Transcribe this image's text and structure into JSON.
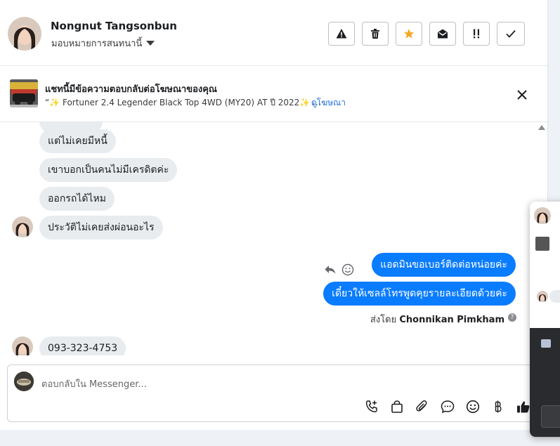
{
  "header": {
    "contact_name": "Nongnut Tangsonbun",
    "assign_label": "มอบหมายการสนทนานี้"
  },
  "toolbar": {
    "buttons": [
      {
        "name": "report-button",
        "icon": "warning-icon"
      },
      {
        "name": "delete-button",
        "icon": "trash-icon"
      },
      {
        "name": "star-button",
        "icon": "star-icon",
        "color": "#f5a623"
      },
      {
        "name": "mark-unread-button",
        "icon": "open-envelope-icon"
      },
      {
        "name": "important-button",
        "icon": "double-exclamation-icon"
      },
      {
        "name": "done-button",
        "icon": "checkmark-icon"
      }
    ]
  },
  "ad_banner": {
    "title": "แชทนี้มีข้อความตอบกลับต่อโฆษณาของคุณ",
    "subtitle": "“✨ Fortuner 2.4 Legender Black Top 4WD (MY20) AT ปี 2022✨ ...",
    "link": "ดูโฆษณา"
  },
  "messages": [
    {
      "dir": "in",
      "text": "แต่ไม่เคยมีหนี้"
    },
    {
      "dir": "in",
      "text": "เขาบอกเป็นคนไม่มีเครดิตค่ะ"
    },
    {
      "dir": "in",
      "text": "ออกรถได้ไหม"
    },
    {
      "dir": "in",
      "text": "ประวัติไม่เคยส่งผ่อนอะไร"
    },
    {
      "dir": "out",
      "text": "แอดมินขอเบอร์ติดต่อหน่อยค่ะ"
    },
    {
      "dir": "out",
      "text": "เดี๋ยวให้เซลล์โทรพูดคุยรายละเอียดด้วยค่ะ"
    },
    {
      "dir": "in",
      "text": "093-323-4753"
    }
  ],
  "sent_by": {
    "prefix": "ส่งโดย",
    "name": "Chonnikan Pimkham"
  },
  "composer": {
    "placeholder": "ตอบกลับใน Messenger...",
    "icons": [
      "call-icon",
      "shopping-bag-icon",
      "paperclip-icon",
      "chat-bubble-icon",
      "emoji-icon",
      "baht-icon",
      "thumbs-up-icon"
    ]
  },
  "colors": {
    "accent": "#0a7cff",
    "link": "#216fdb",
    "star": "#f5a623"
  }
}
